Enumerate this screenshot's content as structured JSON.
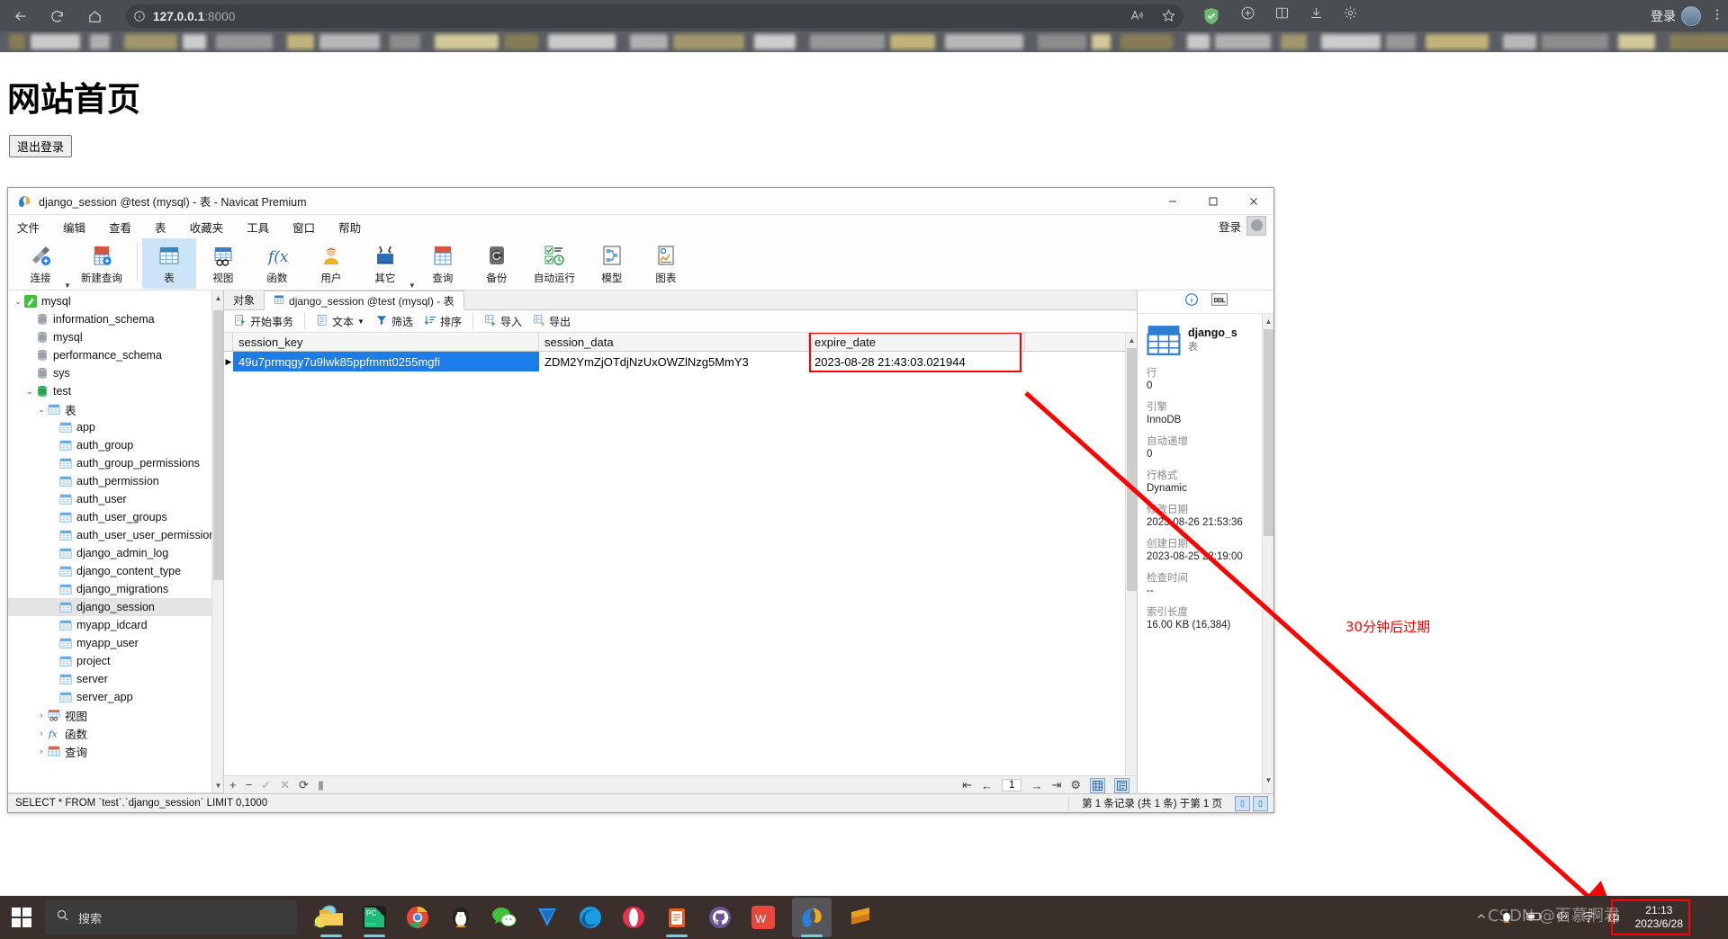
{
  "browser": {
    "url_host": "127.0.0.1",
    "url_port": ":8000",
    "back_icon": "back-arrow-icon",
    "reload_icon": "reload-icon",
    "home_icon": "home-icon",
    "info_icon": "site-info-icon",
    "read_aloud_icon": "read-aloud-icon",
    "favorite_icon": "star-icon",
    "extension_icon": "adguard-shield-icon",
    "collections_icon": "collections-icon",
    "split_icon": "split-screen-icon",
    "downloads_icon": "download-icon",
    "settings_icon": "browser-settings-icon",
    "login_label": "登录",
    "window_more": "…"
  },
  "webpage": {
    "title": "网站首页",
    "logout_label": "退出登录"
  },
  "navicat": {
    "title": "django_session @test (mysql) - 表 - Navicat Premium",
    "window_buttons": {
      "minimize": "—",
      "maximize": "☐",
      "close": "✕"
    },
    "login_label": "登录",
    "menu": [
      "文件",
      "编辑",
      "查看",
      "表",
      "收藏夹",
      "工具",
      "窗口",
      "帮助"
    ],
    "toolbar": [
      {
        "label": "连接",
        "icon": "connection-icon",
        "caret": true,
        "active": false
      },
      {
        "label": "新建查询",
        "icon": "new-query-icon",
        "caret": false,
        "active": false
      },
      {
        "label": "表",
        "icon": "table-icon",
        "caret": false,
        "active": true
      },
      {
        "label": "视图",
        "icon": "view-icon",
        "caret": false,
        "active": false
      },
      {
        "label": "函数",
        "icon": "function-icon",
        "caret": false,
        "active": false
      },
      {
        "label": "用户",
        "icon": "user-icon",
        "caret": false,
        "active": false
      },
      {
        "label": "其它",
        "icon": "other-tools-icon",
        "caret": true,
        "active": false
      },
      {
        "label": "查询",
        "icon": "query-icon",
        "caret": false,
        "active": false
      },
      {
        "label": "备份",
        "icon": "backup-icon",
        "caret": false,
        "active": false
      },
      {
        "label": "自动运行",
        "icon": "automation-icon",
        "caret": false,
        "active": false
      },
      {
        "label": "模型",
        "icon": "model-icon",
        "caret": false,
        "active": false
      },
      {
        "label": "图表",
        "icon": "chart-icon",
        "caret": false,
        "active": false
      }
    ],
    "tree": [
      {
        "label": "mysql",
        "depth": 0,
        "twisty": "v",
        "icon": "connection-green-icon",
        "selected": false
      },
      {
        "label": "information_schema",
        "depth": 1,
        "twisty": "",
        "icon": "database-icon",
        "selected": false
      },
      {
        "label": "mysql",
        "depth": 1,
        "twisty": "",
        "icon": "database-icon",
        "selected": false
      },
      {
        "label": "performance_schema",
        "depth": 1,
        "twisty": "",
        "icon": "database-icon",
        "selected": false
      },
      {
        "label": "sys",
        "depth": 1,
        "twisty": "",
        "icon": "database-icon",
        "selected": false
      },
      {
        "label": "test",
        "depth": 1,
        "twisty": "v",
        "icon": "database-green-icon",
        "selected": false
      },
      {
        "label": "表",
        "depth": 2,
        "twisty": "v",
        "icon": "table-folder-icon",
        "selected": false
      },
      {
        "label": "app",
        "depth": 3,
        "twisty": "",
        "icon": "table-icon",
        "selected": false
      },
      {
        "label": "auth_group",
        "depth": 3,
        "twisty": "",
        "icon": "table-icon",
        "selected": false
      },
      {
        "label": "auth_group_permissions",
        "depth": 3,
        "twisty": "",
        "icon": "table-icon",
        "selected": false
      },
      {
        "label": "auth_permission",
        "depth": 3,
        "twisty": "",
        "icon": "table-icon",
        "selected": false
      },
      {
        "label": "auth_user",
        "depth": 3,
        "twisty": "",
        "icon": "table-icon",
        "selected": false
      },
      {
        "label": "auth_user_groups",
        "depth": 3,
        "twisty": "",
        "icon": "table-icon",
        "selected": false
      },
      {
        "label": "auth_user_user_permission",
        "depth": 3,
        "twisty": "",
        "icon": "table-icon",
        "selected": false
      },
      {
        "label": "django_admin_log",
        "depth": 3,
        "twisty": "",
        "icon": "table-icon",
        "selected": false
      },
      {
        "label": "django_content_type",
        "depth": 3,
        "twisty": "",
        "icon": "table-icon",
        "selected": false
      },
      {
        "label": "django_migrations",
        "depth": 3,
        "twisty": "",
        "icon": "table-icon",
        "selected": false
      },
      {
        "label": "django_session",
        "depth": 3,
        "twisty": "",
        "icon": "table-icon",
        "selected": true
      },
      {
        "label": "myapp_idcard",
        "depth": 3,
        "twisty": "",
        "icon": "table-icon",
        "selected": false
      },
      {
        "label": "myapp_user",
        "depth": 3,
        "twisty": "",
        "icon": "table-icon",
        "selected": false
      },
      {
        "label": "project",
        "depth": 3,
        "twisty": "",
        "icon": "table-icon",
        "selected": false
      },
      {
        "label": "server",
        "depth": 3,
        "twisty": "",
        "icon": "table-icon",
        "selected": false
      },
      {
        "label": "server_app",
        "depth": 3,
        "twisty": "",
        "icon": "table-icon",
        "selected": false
      },
      {
        "label": "视图",
        "depth": 2,
        "twisty": ">",
        "icon": "view-folder-icon",
        "selected": false
      },
      {
        "label": "函数",
        "depth": 2,
        "twisty": ">",
        "icon": "function-folder-icon",
        "selected": false
      },
      {
        "label": "查询",
        "depth": 2,
        "twisty": ">",
        "icon": "query-folder-icon",
        "selected": false
      }
    ],
    "tabs": [
      {
        "label": "对象",
        "active": false,
        "icon": ""
      },
      {
        "label": "django_session @test (mysql) - 表",
        "active": true,
        "icon": "table-icon"
      }
    ],
    "grid_toolbar": [
      {
        "label": "开始事务",
        "icon": "transaction-icon",
        "caret": false
      },
      {
        "label": "文本",
        "icon": "text-icon",
        "caret": true
      },
      {
        "label": "筛选",
        "icon": "filter-icon",
        "caret": false
      },
      {
        "label": "排序",
        "icon": "sort-icon",
        "caret": false
      },
      {
        "label": "导入",
        "icon": "import-icon",
        "caret": false
      },
      {
        "label": "导出",
        "icon": "export-icon",
        "caret": false
      }
    ],
    "grid": {
      "columns": [
        "session_key",
        "session_data",
        "expire_date"
      ],
      "rows": [
        [
          "49u7prmqgy7u9lwk85ppfmmt0255mgfi",
          "ZDM2YmZjOTdjNzUxOWZlNzg5MmY3",
          "2023-08-28 21:43:03.021944"
        ]
      ],
      "highlight_color": "#ff0000"
    },
    "row_toolbar": [
      "+",
      "−",
      "✓",
      "✕",
      "⟳",
      "▮"
    ],
    "pager": {
      "first": "⇤",
      "prev": "←",
      "page": "1",
      "next": "→",
      "last": "⇥",
      "settings": "⚙",
      "grid_view_icon": "grid-view-icon",
      "form_view_icon": "form-view-icon"
    },
    "status": {
      "sql": "SELECT * FROM `test`.`django_session` LIMIT 0,1000",
      "record_count": "第 1 条记录 (共 1 条) 于第 1 页"
    },
    "info_panel": {
      "tab_info_icon": "info-circle-icon",
      "tab_ddl_icon": "ddl-icon",
      "object_name": "django_s",
      "object_type": "表",
      "fields": [
        {
          "key": "行",
          "value": "0"
        },
        {
          "key": "引擎",
          "value": "InnoDB"
        },
        {
          "key": "自动递增",
          "value": "0"
        },
        {
          "key": "行格式",
          "value": "Dynamic"
        },
        {
          "key": "修改日期",
          "value": "2023-08-26 21:53:36"
        },
        {
          "key": "创建日期",
          "value": "2023-08-25 22:19:00"
        },
        {
          "key": "检查时间",
          "value": "--"
        },
        {
          "key": "索引长度",
          "value": "16.00 KB (16,384)"
        }
      ]
    }
  },
  "annotation": {
    "text": "30分钟后过期",
    "color": "#ff0000"
  },
  "taskbar": {
    "start_icon": "windows-start-icon",
    "search_placeholder": "搜索",
    "search_icon": "search-icon",
    "apps": [
      {
        "name": "file-explorer-icon",
        "running": true
      },
      {
        "name": "pycharm-icon",
        "running": true
      },
      {
        "name": "chrome-icon",
        "running": false
      },
      {
        "name": "qq-icon",
        "running": false
      },
      {
        "name": "wechat-icon",
        "running": false
      },
      {
        "name": "dingtalk-icon",
        "running": false
      },
      {
        "name": "edge-icon",
        "running": false
      },
      {
        "name": "opera-icon",
        "running": false
      },
      {
        "name": "clipboard-icon",
        "running": false
      },
      {
        "name": "github-icon",
        "running": false
      },
      {
        "name": "wps-icon",
        "running": false
      },
      {
        "name": "navicat-icon",
        "running": true
      },
      {
        "name": "sublime-icon",
        "running": false
      }
    ],
    "tray": [
      "^",
      "qq-tray-icon",
      "battery-icon",
      "volume-icon",
      "wifi-icon",
      "ime-icon"
    ],
    "clock_time": "21:13",
    "clock_date": "2023/6/28",
    "watermark": "CSDN @百慕啊君"
  }
}
